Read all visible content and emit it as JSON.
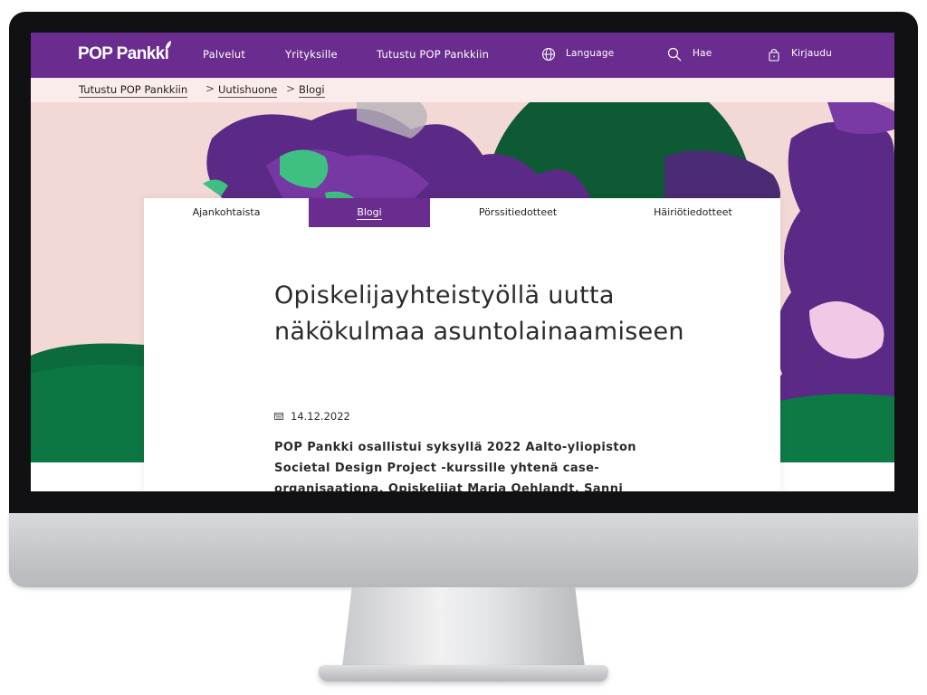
{
  "colors": {
    "brand_purple": "#6a2c8e",
    "dark_green": "#0d5a34",
    "accent_green": "#3fbf82",
    "pink_background": "#f3d9d6"
  },
  "header": {
    "logo": "POP Pankki",
    "nav": {
      "palvelut": "Palvelut",
      "yrityksille": "Yrityksille",
      "tutustu": "Tutustu POP Pankkiin"
    },
    "language_label": "Language",
    "language_icon": "globe-icon",
    "search_label": "Hae",
    "search_icon": "search-icon",
    "login_label": "Kirjaudu",
    "login_icon": "lock-icon"
  },
  "breadcrumb": {
    "items": [
      "Tutustu POP Pankkiin",
      "Uutishuone",
      "Blogi"
    ],
    "separator": ">"
  },
  "tabs": [
    {
      "label": "Ajankohtaista",
      "active": false
    },
    {
      "label": "Blogi",
      "active": true
    },
    {
      "label": "Pörssitiedotteet",
      "active": false
    },
    {
      "label": "Häiriötiedotteet",
      "active": false
    }
  ],
  "article": {
    "title": "Opiskelijayhteistyöllä uutta näkökulmaa asuntolainaamiseen",
    "date": "14.12.2022",
    "date_icon": "calendar-icon",
    "lead": "POP Pankki osallistui syksyllä 2022 Aalto-yliopiston Societal Design Project -kurssille yhtenä case-organisaationa. Opiskelijat Maria Oehlandt, Sanni"
  }
}
